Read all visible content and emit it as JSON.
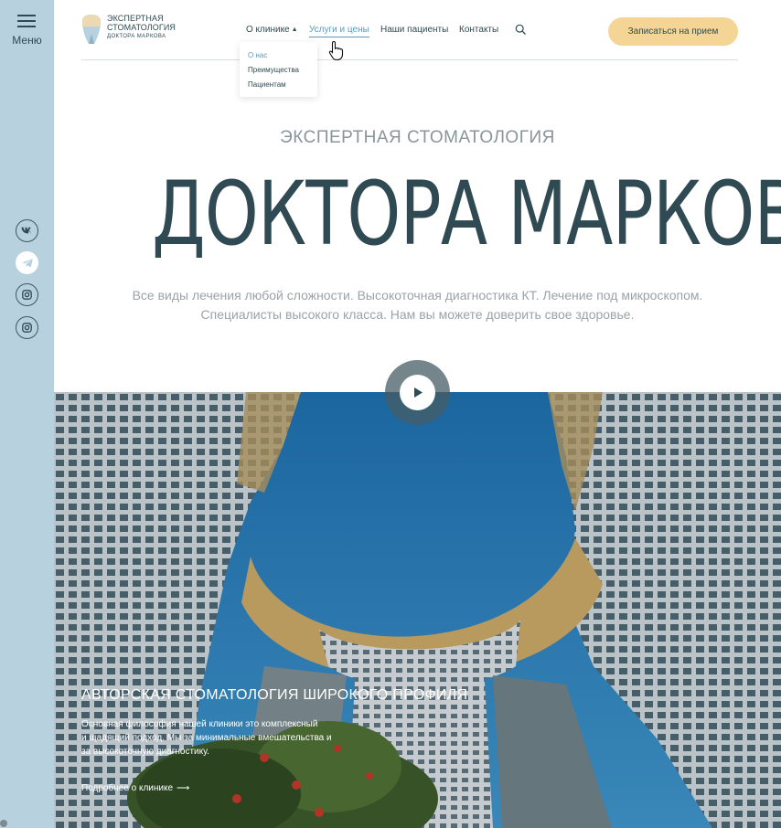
{
  "sidebar": {
    "menu_label": "Меню",
    "socials": [
      "vk-icon",
      "telegram-icon",
      "instagram-icon",
      "instagram-icon"
    ]
  },
  "logo": {
    "line1": "ЭКСПЕРТНАЯ",
    "line2": "СТОМАТОЛОГИЯ",
    "line3": "ДОКТОРА МАРКОВА"
  },
  "nav": {
    "about": "О клинике",
    "services": "Услуги и цены",
    "patients": "Наши пациенты",
    "contacts": "Контакты"
  },
  "dropdown": {
    "items": [
      "О нас",
      "Преимущества",
      "Пациентам"
    ]
  },
  "cta_label": "Записаться на прием",
  "hero": {
    "kicker": "ЭКСПЕРТНАЯ СТОМАТОЛОГИЯ",
    "title": "ДОКТОРА МАРКОВА",
    "lead_line1": "Все виды лечения любой сложности. Высокоточная диагностика КТ. Лечение под микроскопом.",
    "lead_line2": "Специалисты высокого класса. Нам вы можете доверить свое здоровье."
  },
  "about_block": {
    "title": "АВТОРСКАЯ СТОМАТОЛОГИЯ ШИРОКОГО ПРОФИЛЯ",
    "text_line1": "Основная философия нашей клиники это комплексный",
    "text_line2": "и щадящий подход. Мы за минимальные вмешательства и",
    "text_line3": "за высокоточную диагностику.",
    "link": "Подробнее о клинике"
  },
  "colors": {
    "sidebar_bg": "#b8d1de",
    "accent": "#5d9bb8",
    "cta_bg": "#f4d596",
    "text_dark": "#2f4a52",
    "sky": "#2e7fb8"
  }
}
